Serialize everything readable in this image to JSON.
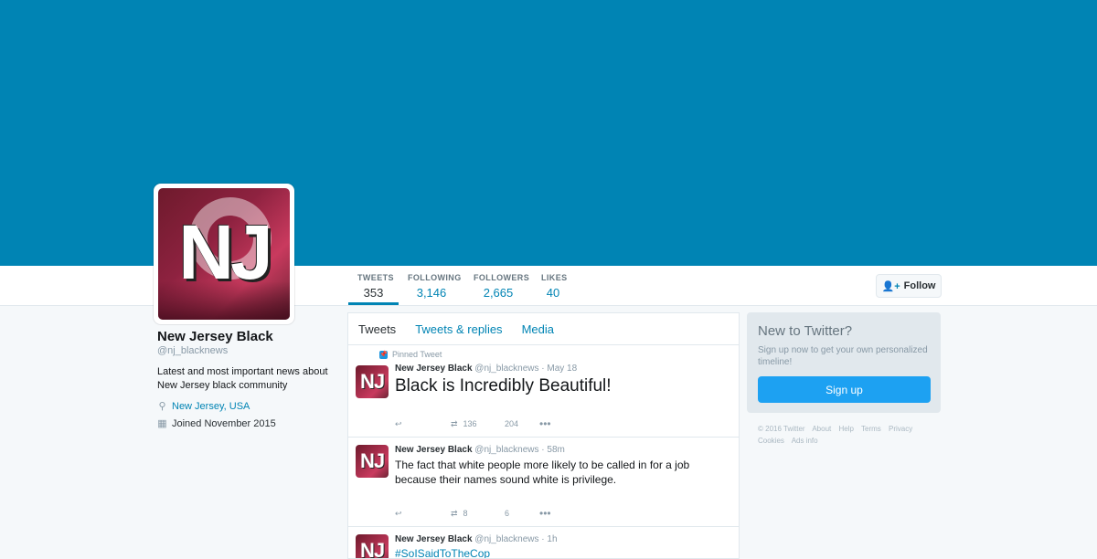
{
  "profile": {
    "name": "New Jersey Black",
    "handle": "@nj_blacknews",
    "bio": "Latest and most important news about New Jersey black community",
    "location": "New Jersey, USA",
    "joined": "Joined November 2015",
    "avatar_text": "NJ"
  },
  "stats": [
    {
      "label": "TWEETS",
      "value": "353"
    },
    {
      "label": "FOLLOWING",
      "value": "3,146"
    },
    {
      "label": "FOLLOWERS",
      "value": "2,665"
    },
    {
      "label": "LIKES",
      "value": "40"
    }
  ],
  "follow_label": "Follow",
  "tabs": [
    "Tweets",
    "Tweets & replies",
    "Media"
  ],
  "pinned_label": "Pinned Tweet",
  "tweets": [
    {
      "name": "New Jersey Black",
      "handle": "@nj_blacknews",
      "time": "May 18",
      "text": "Black is Incredibly Beautiful!",
      "retweets": "136",
      "likes": "204"
    },
    {
      "name": "New Jersey Black",
      "handle": "@nj_blacknews",
      "time": "58m",
      "text": "The fact that white people more likely to be called in for a job because their names sound white is privilege.",
      "retweets": "8",
      "likes": "6"
    },
    {
      "name": "New Jersey Black",
      "handle": "@nj_blacknews",
      "time": "1h",
      "text": "#SoISaidToTheCop"
    }
  ],
  "sidebar": {
    "heading": "New to Twitter?",
    "text": "Sign up now to get your own personalized timeline!",
    "signup": "Sign up"
  },
  "footer": {
    "copyright": "© 2016 Twitter",
    "links": [
      "About",
      "Help",
      "Terms",
      "Privacy",
      "Cookies",
      "Ads info"
    ]
  },
  "colors": {
    "banner": "#0084b4",
    "link": "#0084b4",
    "signup": "#1da1f2"
  }
}
